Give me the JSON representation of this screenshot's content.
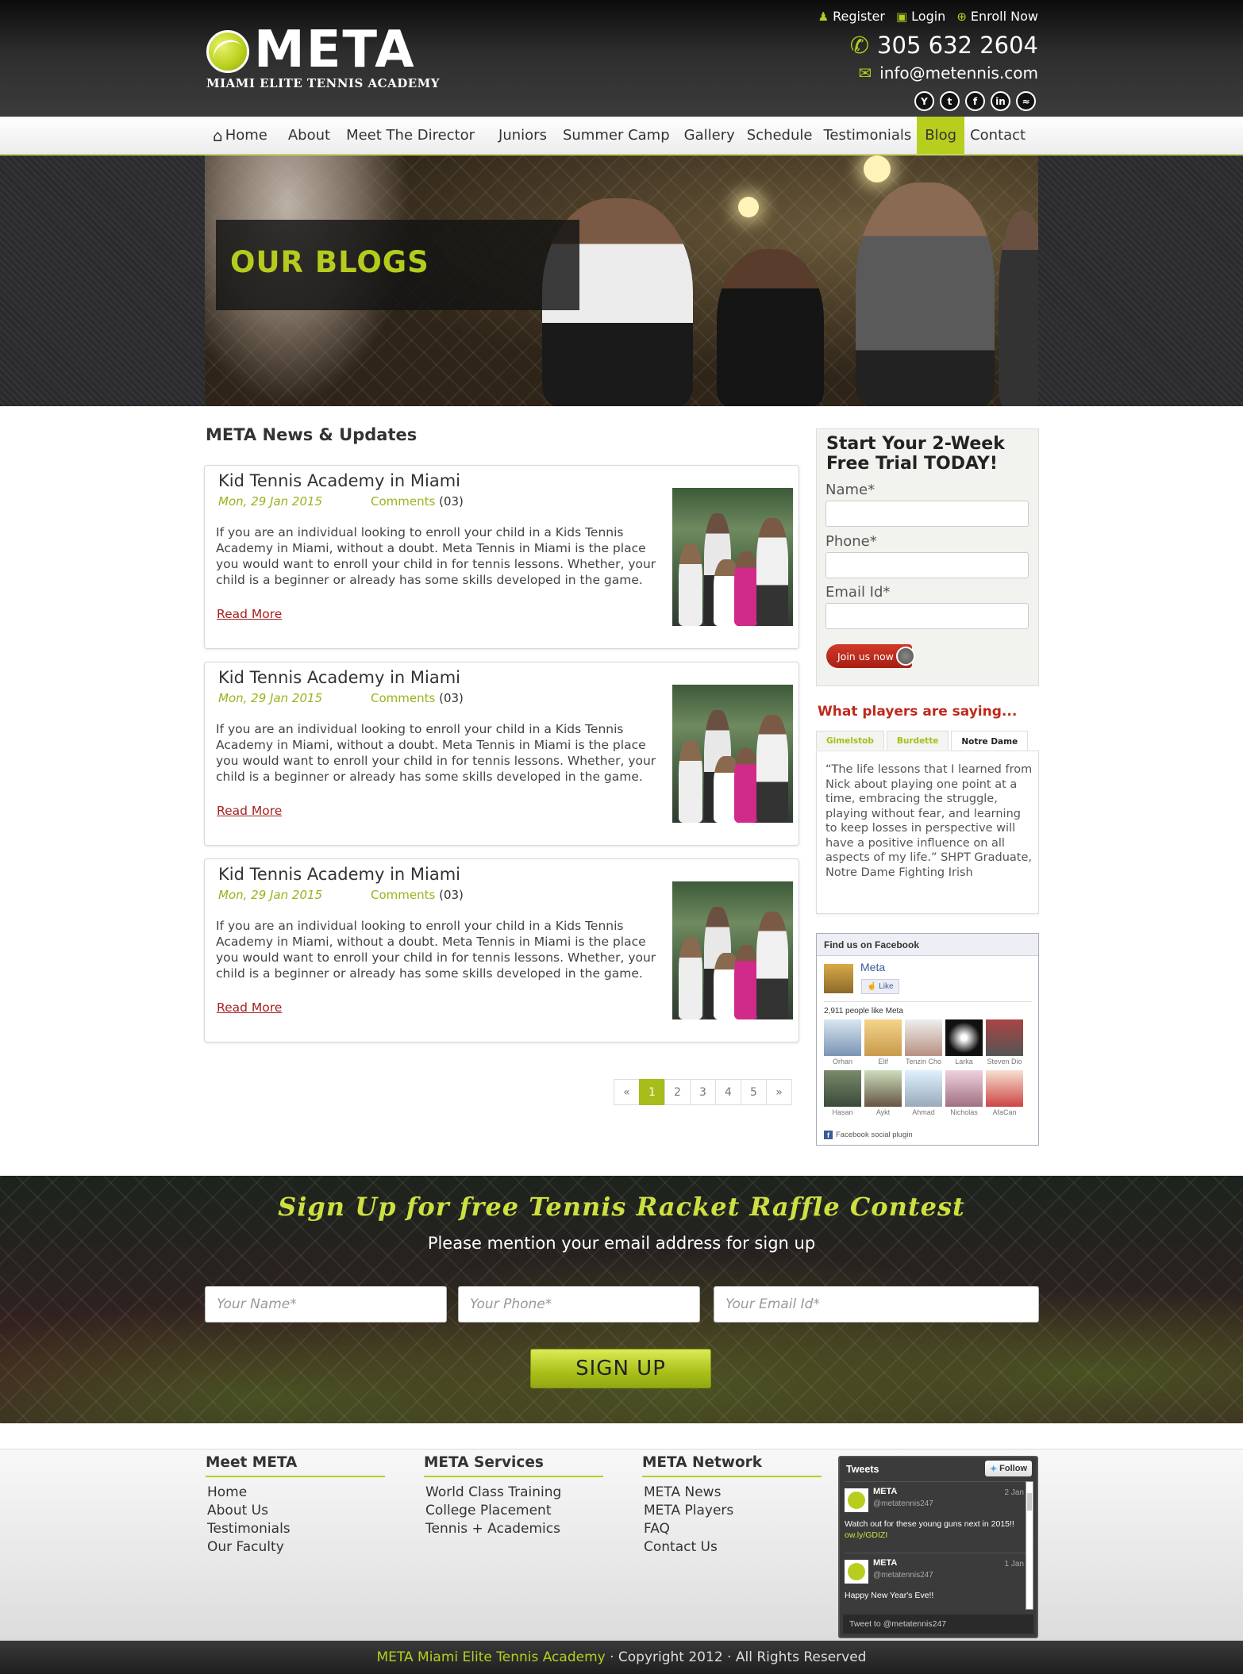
{
  "header": {
    "logo_word": "META",
    "logo_sub": "MIAMI ELITE TENNIS ACADEMY",
    "top_links": [
      "Register",
      "Login",
      "Enroll Now"
    ],
    "phone": "305 632 2604",
    "email": "info@metennis.com",
    "socials": [
      "youtube-icon",
      "tumblr-icon",
      "facebook-icon",
      "linkedin-icon",
      "rss-icon"
    ]
  },
  "nav": {
    "items": [
      "Home",
      "About",
      "Meet The Director",
      "Juniors",
      "Summer Camp",
      "Gallery",
      "Schedule",
      "Testimonials",
      "Blog",
      "Contact"
    ],
    "active": "Blog"
  },
  "banner": {
    "title": "OUR BLOGS"
  },
  "main": {
    "title": "META News & Updates",
    "posts": [
      {
        "title": "Kid Tennis Academy in Miami",
        "date": "Mon, 29 Jan 2015",
        "comments_label": "Comments",
        "comments_count": "(03)",
        "body": "If you are an individual looking to enroll your child in a Kids Tennis Academy in Miami, without a doubt. Meta Tennis in Miami is the place you would want to enroll your child in for tennis lessons. Whether, your child is a beginner or already has some skills developed in the game.",
        "read_more": "Read More"
      },
      {
        "title": "Kid Tennis Academy in Miami",
        "date": "Mon, 29 Jan 2015",
        "comments_label": "Comments",
        "comments_count": "(03)",
        "body": "If you are an individual looking to enroll your child in a Kids Tennis Academy in Miami, without a doubt. Meta Tennis in Miami is the place you would want to enroll your child in for tennis lessons. Whether, your child is a beginner or already has some skills developed in the game.",
        "read_more": "Read More"
      },
      {
        "title": "Kid Tennis Academy in Miami",
        "date": "Mon, 29 Jan 2015",
        "comments_label": "Comments",
        "comments_count": "(03)",
        "body": "If you are an individual looking to enroll your child in a Kids Tennis Academy in Miami, without a doubt. Meta Tennis in Miami is the place you would want to enroll your child in for tennis lessons. Whether, your child is a beginner or already has some skills developed in the game.",
        "read_more": "Read More"
      }
    ],
    "pagination": [
      "«",
      "1",
      "2",
      "3",
      "4",
      "5",
      "»"
    ],
    "current_page": "1"
  },
  "sidebar": {
    "trial": {
      "title": "Start Your 2-Week Free Trial TODAY!",
      "name_label": "Name*",
      "phone_label": "Phone*",
      "email_label": "Email Id*",
      "button": "Join us now"
    },
    "players_title": "What players are saying...",
    "tabs": [
      "Gimelstob",
      "Burdette",
      "Notre Dame"
    ],
    "active_tab": "Notre Dame",
    "quote": "“The life lessons that I learned from Nick about playing one point at a time, embracing the struggle, playing without fear, and learning to keep losses in perspective will have a positive influence on all aspects of my life.” SHPT Graduate, Notre Dame Fighting Irish",
    "facebook": {
      "header": "Find us on Facebook",
      "page_name": "Meta",
      "like": "Like",
      "count": "2,911 people like Meta",
      "faces": [
        "Orhan",
        "Elif",
        "Tenzin Cho",
        "Larka",
        "Steven Dio",
        "Hasan",
        "Aykt",
        "Ahmad",
        "Nicholas",
        "AfaCan"
      ],
      "footer": "Facebook social plugin"
    }
  },
  "raffle": {
    "title": "Sign Up for free Tennis Racket Raffle Contest",
    "subtitle": "Please mention your email address for sign up",
    "name_placeholder": "Your Name*",
    "phone_placeholder": "Your Phone*",
    "email_placeholder": "Your Email Id*",
    "button": "SIGN UP"
  },
  "footer": {
    "cols": [
      {
        "title": "Meet META",
        "links": [
          "Home",
          "About Us",
          "Testimonials",
          "Our Faculty"
        ]
      },
      {
        "title": "META Services",
        "links": [
          "World Class Training",
          "College Placement",
          "Tennis + Academics"
        ]
      },
      {
        "title": "META Network",
        "links": [
          "META News",
          "META Players",
          "FAQ",
          "Contact Us"
        ]
      }
    ],
    "tweets": {
      "header": "Tweets",
      "follow": "Follow",
      "items": [
        {
          "name": "META",
          "handle": "@metatennis247",
          "date": "2 Jan",
          "text": "Watch out for these young guns next in 2015!! ",
          "link": "ow.ly/GDIZI"
        },
        {
          "name": "META",
          "handle": "@metatennis247",
          "date": "1 Jan",
          "text": "Happy New Year's Eve!!",
          "link": ""
        }
      ],
      "tweet_to": "Tweet to @metatennis247"
    },
    "copyright_brand": "META Miami Elite Tennis Academy",
    "copyright_rest": " · Copyright 2012 · All Rights Reserved"
  }
}
